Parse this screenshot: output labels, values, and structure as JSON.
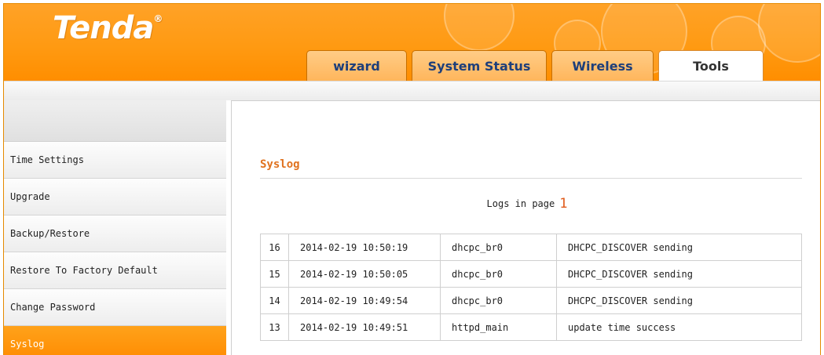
{
  "brand": {
    "logo_text": "Tenda",
    "registered_mark": "®",
    "primary_color": "#ff9a12",
    "accent_color": "#e0721f"
  },
  "tabs": [
    {
      "label": "wizard",
      "active": false
    },
    {
      "label": "System Status",
      "active": false
    },
    {
      "label": "Wireless",
      "active": false
    },
    {
      "label": "Tools",
      "active": true
    }
  ],
  "sidebar": {
    "items": [
      {
        "label": "Time Settings",
        "active": false
      },
      {
        "label": "Upgrade",
        "active": false
      },
      {
        "label": "Backup/Restore",
        "active": false
      },
      {
        "label": "Restore To Factory Default",
        "active": false
      },
      {
        "label": "Change Password",
        "active": false
      },
      {
        "label": "Syslog",
        "active": true
      }
    ]
  },
  "main": {
    "section_title": "Syslog",
    "logs_label": "Logs in page",
    "current_page": "1",
    "log_rows": [
      {
        "no": "16",
        "time": "2014-02-19 10:50:19",
        "source": "dhcpc_br0",
        "message": "DHCPC_DISCOVER sending"
      },
      {
        "no": "15",
        "time": "2014-02-19 10:50:05",
        "source": "dhcpc_br0",
        "message": "DHCPC_DISCOVER sending"
      },
      {
        "no": "14",
        "time": "2014-02-19 10:49:54",
        "source": "dhcpc_br0",
        "message": "DHCPC_DISCOVER sending"
      },
      {
        "no": "13",
        "time": "2014-02-19 10:49:51",
        "source": "httpd_main",
        "message": "update time success"
      }
    ]
  }
}
